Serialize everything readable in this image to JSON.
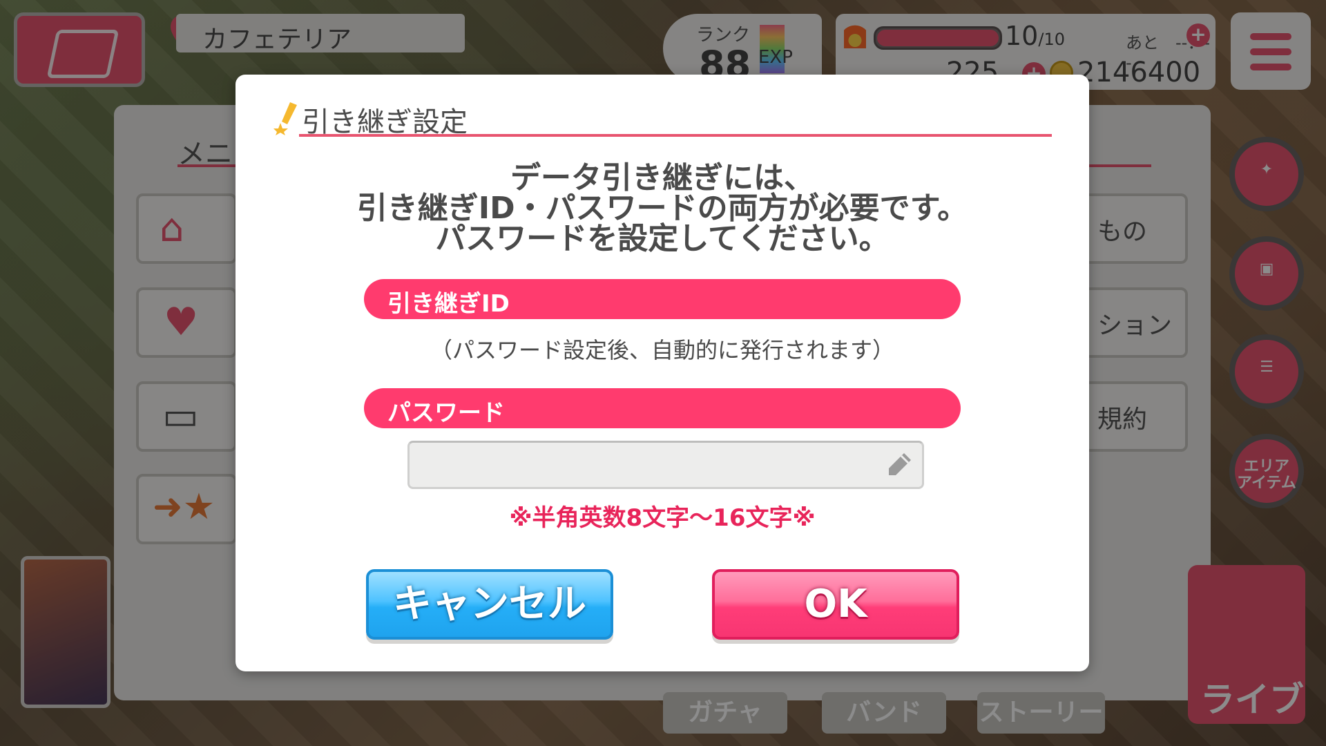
{
  "hud": {
    "location": "カフェテリア",
    "rank_label": "ランク",
    "rank_value": "88",
    "exp_label": "EXP",
    "stamina_value": "10",
    "stamina_max": "/10",
    "timer": "あと　--：--",
    "gems": "225",
    "coins": "2146400",
    "stamina_progress": 1.0
  },
  "side_buttons": [
    {
      "icon": "star-pen-icon",
      "label": ""
    },
    {
      "icon": "gift-icon",
      "label": ""
    },
    {
      "icon": "checklist-icon",
      "label": ""
    },
    {
      "icon": "area-item-icon",
      "label": "エリア\nアイテム"
    }
  ],
  "menu": {
    "title": "メニ",
    "right_items": [
      "もの",
      "ション",
      "規約"
    ],
    "tabs": [
      "ガチャ",
      "バンド",
      "ストーリー"
    ],
    "live_label": "ライブ"
  },
  "dialog": {
    "title": "引き継ぎ設定",
    "message_lines": [
      "データ引き継ぎには、",
      "引き継ぎID・パスワードの両方が必要です。",
      "パスワードを設定してください。"
    ],
    "id_section_label": "引き継ぎID",
    "id_note": "（パスワード設定後、自動的に発行されます）",
    "password_section_label": "パスワード",
    "password_value": "",
    "password_rule": "※半角英数8文字～16文字※",
    "cancel_label": "キャンセル",
    "ok_label": "OK"
  },
  "colors": {
    "accent_pink": "#ff3b6e",
    "rule_red": "#e8245a",
    "cancel_blue": "#25aef7",
    "ok_pink": "#f73572"
  }
}
